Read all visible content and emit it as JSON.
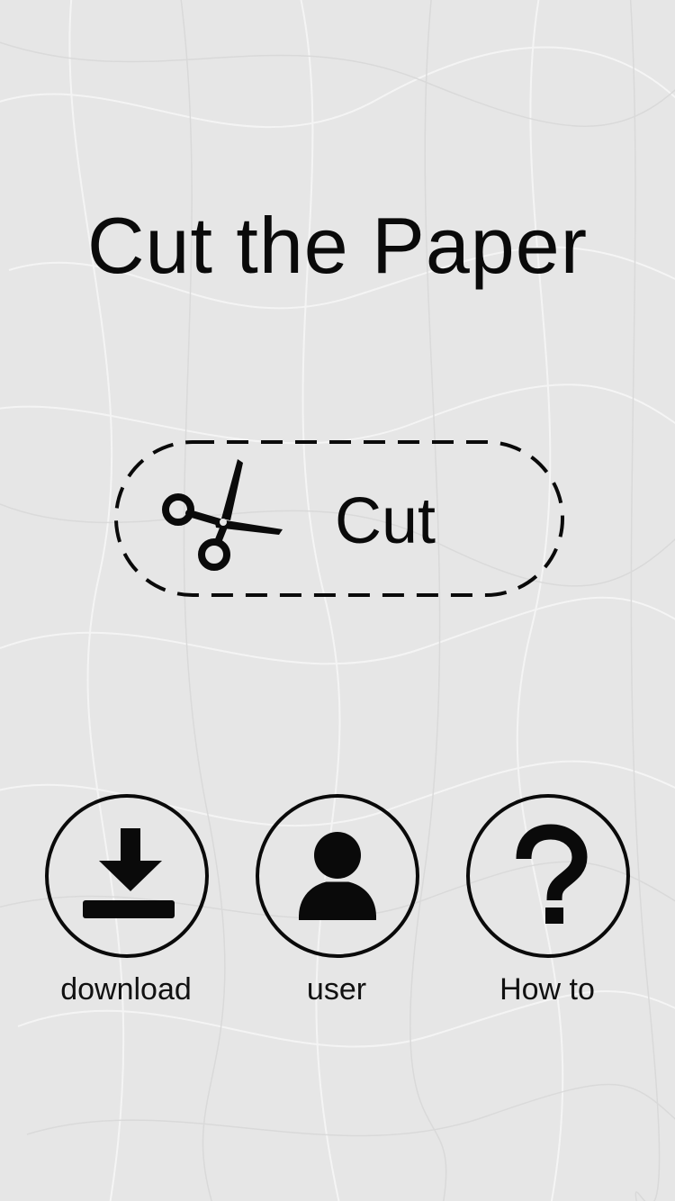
{
  "app": {
    "title": "Cut the Paper"
  },
  "main_action": {
    "label": "Cut",
    "icon": "scissors-icon"
  },
  "menu": [
    {
      "id": "download",
      "label": "download",
      "icon": "download-icon"
    },
    {
      "id": "user",
      "label": "user",
      "icon": "user-icon"
    },
    {
      "id": "howto",
      "label": "How to",
      "icon": "question-mark-icon"
    }
  ],
  "colors": {
    "background": "#e8e8e8",
    "ink": "#0a0a0a"
  }
}
